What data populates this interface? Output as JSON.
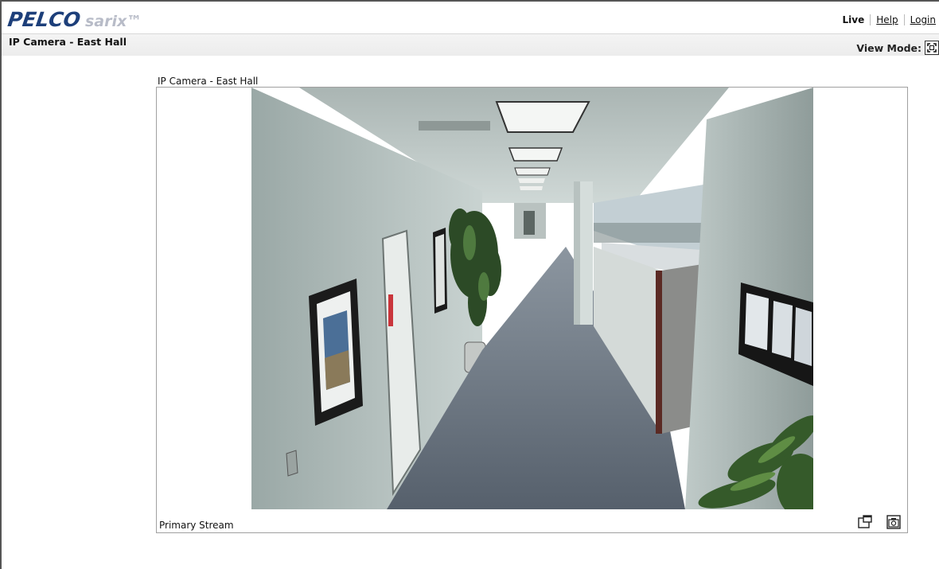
{
  "header": {
    "brand": "PELCO",
    "product": "sarix™",
    "nav": {
      "live": "Live",
      "help": "Help",
      "login": "Login"
    }
  },
  "subheader": {
    "title": "IP Camera - East Hall",
    "view_mode_label": "View Mode:"
  },
  "camera": {
    "label": "IP Camera - East Hall",
    "stream_label": "Primary Stream"
  },
  "icons": {
    "view_mode": "fullscreen-icon",
    "popout": "popout-window-icon",
    "snapshot": "snapshot-camera-icon"
  },
  "colors": {
    "brand": "#1d3f7a",
    "product": "#b8bcc8",
    "subbar": "#ececec",
    "border": "#a0a0a0"
  }
}
